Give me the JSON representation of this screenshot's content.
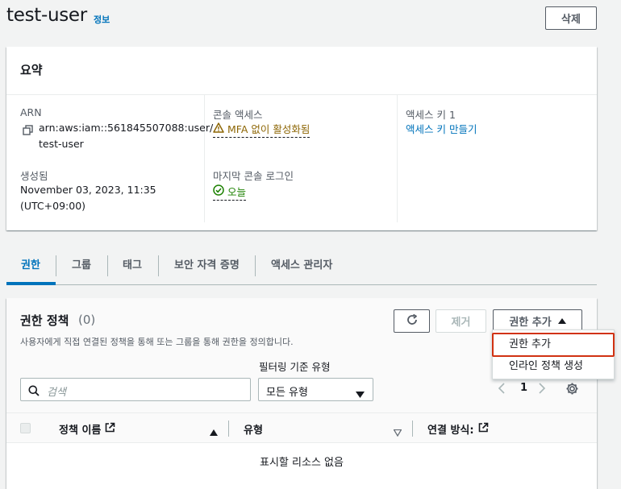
{
  "header": {
    "title": "test-user",
    "info_link": "정보",
    "delete_button": "삭제"
  },
  "summary": {
    "title": "요약",
    "arn_label": "ARN",
    "arn_line1": "arn:aws:iam::561845507088:user/",
    "arn_line2": "test-user",
    "created_label": "생성됨",
    "created_line1": "November 03, 2023, 11:35",
    "created_line2": "(UTC+09:00)",
    "console_access_label": "콘솔 액세스",
    "console_access_value": "MFA 없이 활성화됨",
    "last_login_label": "마지막 콘솔 로그인",
    "last_login_value": "오늘",
    "access_key_label": "액세스 키 1",
    "access_key_link": "액세스 키 만들기"
  },
  "tabs": [
    {
      "label": "권한"
    },
    {
      "label": "그룹"
    },
    {
      "label": "태그"
    },
    {
      "label": "보안 자격 증명"
    },
    {
      "label": "액세스 관리자"
    }
  ],
  "permissions": {
    "title": "권한 정책",
    "count": "(0)",
    "description": "사용자에게 직접 연결된 정책을 통해 또는 그룹을 통해 권한을 정의합니다.",
    "refresh_icon": "refresh-icon",
    "remove_button": "제거",
    "add_button": "권한 추가",
    "filter_label": "필터링 기준 유형",
    "search_placeholder": "검색",
    "type_select_value": "모든 유형",
    "page_number": "1",
    "columns": {
      "policy_name": "정책 이름",
      "type": "유형",
      "attached_via": "연결 방식:"
    },
    "empty_message": "표시할 리소스 없음"
  },
  "dropdown": {
    "items": [
      {
        "label": "권한 추가"
      },
      {
        "label": "인라인 정책 생성"
      }
    ]
  },
  "colors": {
    "link": "#0073bb",
    "warning": "#8d6605",
    "success": "#1d8102",
    "highlight": "#d13212"
  }
}
